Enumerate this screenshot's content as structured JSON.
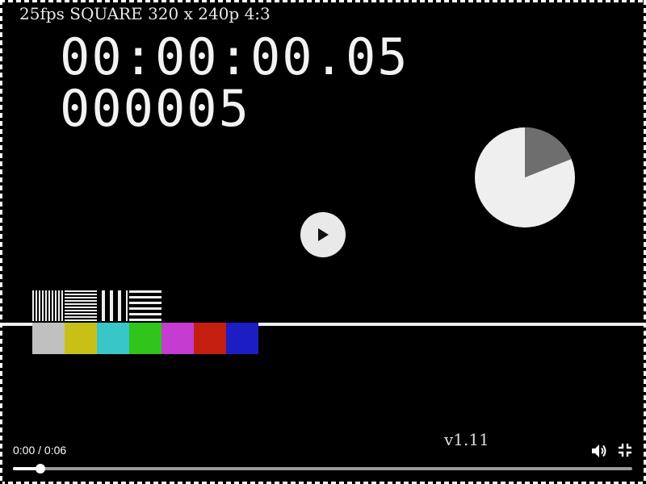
{
  "video": {
    "header_text": "25fps SQUARE 320 x 240p 4:3",
    "timecode": "00:00:00.05",
    "frame_count": "000005",
    "version": "v1.11",
    "pie_dark_fraction": 0.19,
    "color_bars": [
      "#c0c0c0",
      "#c8c016",
      "#38c6c8",
      "#30c41c",
      "#c43cd0",
      "#c41e10",
      "#1c1ec4"
    ]
  },
  "controls": {
    "time_display": "0:00 / 0:06",
    "progress_fraction": 0.044,
    "play_icon": "play-icon",
    "volume_icon": "volume-icon",
    "fullscreen_icon": "exit-fullscreen-icon"
  }
}
